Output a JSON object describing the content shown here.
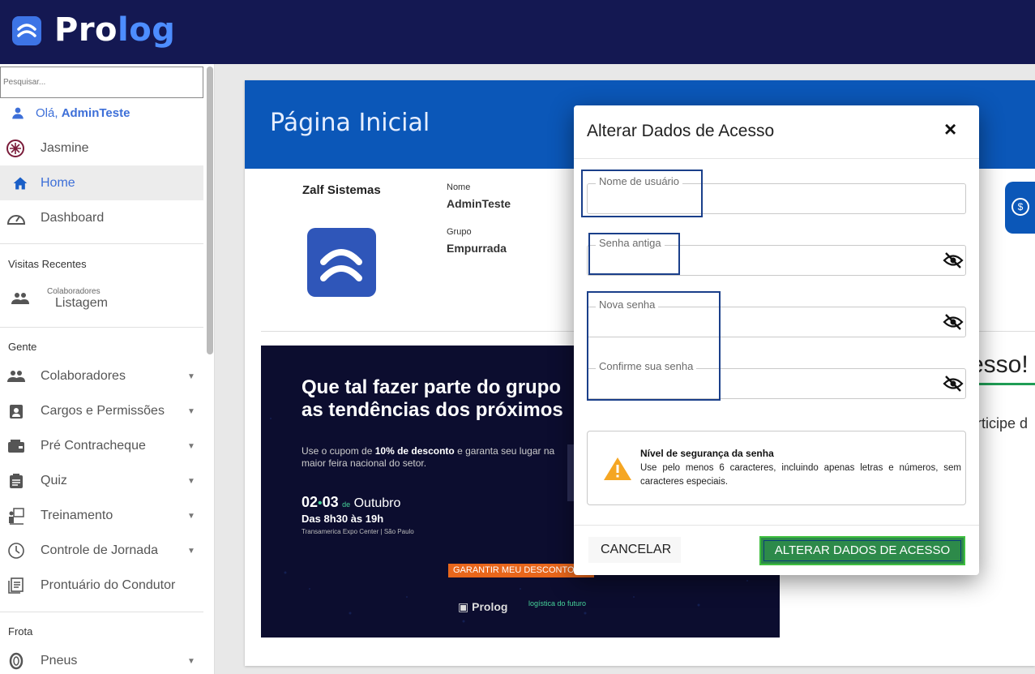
{
  "brand": {
    "name_main": "Pro",
    "name_accent": "log"
  },
  "sidebar": {
    "search_placeholder": "Pesquisar...",
    "greeting_prefix": "Olá, ",
    "user": "AdminTeste",
    "company": "Jasmine",
    "items_top": [
      {
        "label": "Home",
        "icon": "home-icon"
      },
      {
        "label": "Dashboard",
        "icon": "speedometer-icon"
      }
    ],
    "recent_title": "Visitas Recentes",
    "recent": {
      "category": "Colaboradores",
      "label": "Listagem"
    },
    "section_gente": "Gente",
    "gente_items": [
      {
        "label": "Colaboradores",
        "icon": "people-icon"
      },
      {
        "label": "Cargos e Permissões",
        "icon": "badge-icon"
      },
      {
        "label": "Pré Contracheque",
        "icon": "wallet-icon"
      },
      {
        "label": "Quiz",
        "icon": "clipboard-icon"
      },
      {
        "label": "Treinamento",
        "icon": "training-icon"
      },
      {
        "label": "Controle de Jornada",
        "icon": "clock-icon"
      },
      {
        "label": "Prontuário do Condutor",
        "icon": "document-icon"
      }
    ],
    "section_frota": "Frota",
    "frota_items": [
      {
        "label": "Pneus",
        "icon": "tire-icon"
      }
    ]
  },
  "main": {
    "page_title": "Página Inicial",
    "company": "Zalf Sistemas",
    "name_label": "Nome",
    "name_value": "AdminTeste",
    "group_label": "Grupo",
    "group_value": "Empurrada",
    "welcome_partial": "esso!",
    "welcome_sub_partial": "rticipe d"
  },
  "banner": {
    "headline_1": "Que tal fazer parte do grupo",
    "headline_2": "as tendências dos próximos",
    "text_1": "Use o cupom de ",
    "text_bold": "10% de desconto",
    "text_2": " e garanta seu lugar na maior feira nacional do setor.",
    "date_a": "02",
    "date_b": "03",
    "date_de": "de",
    "date_month": "Outubro",
    "time": "Das 8h30 às 19h",
    "place": "Transamerica Expo Center | São Paulo",
    "cta": "GARANTIR MEU DESCONTO",
    "footer_brand": "Prolog",
    "footer_partner": "logística do futuro"
  },
  "dialog": {
    "title": "Alterar Dados de Acesso",
    "close": "×",
    "fields": {
      "username_label": "Nome de usuário",
      "old_password_label": "Senha antiga",
      "new_password_label": "Nova senha",
      "confirm_password_label": "Confirme sua senha"
    },
    "notice": {
      "title": "Nível de segurança da senha",
      "text": "Use pelo menos 6 caracteres, incluindo apenas letras e números, sem caracteres especiais."
    },
    "cancel_label": "CANCELAR",
    "submit_label": "ALTERAR DADOS DE ACESSO"
  },
  "colors": {
    "topbar": "#141852",
    "primary_blue": "#0b57b8",
    "submit_green": "#2d8a4a",
    "warning_orange": "#f5a623"
  }
}
